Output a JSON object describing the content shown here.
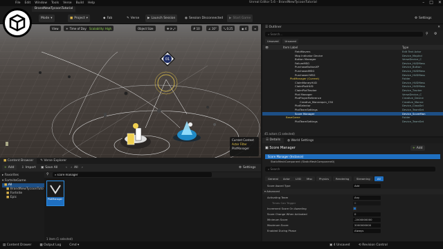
{
  "window": {
    "title": "Unreal Editor 5.6 - BrandNewTycoonTutorial",
    "menus": [
      "File",
      "Edit",
      "Window",
      "Tools",
      "Verse",
      "Build",
      "Help"
    ]
  },
  "toolbar": {
    "project_tab": "BrandNewTycoonTutorial",
    "mode": "Mode",
    "project": "Project",
    "fab": "Fab",
    "verse": "Verse",
    "launch": "Launch Session",
    "session": "Session Disconnected",
    "start": "Start Game",
    "settings": "Settings"
  },
  "viewport": {
    "perspective": "View",
    "time": "Time of Day",
    "scalability": "Scalability: High",
    "object_size": "Object Size",
    "grid": "10",
    "angle": "10°",
    "scale": "0.25",
    "speed": "4",
    "marker_label": "01",
    "context_title": "Current Context",
    "context_filter": "Actor Filter",
    "context_item": "PlotManager"
  },
  "content_browser": {
    "tab": "Content Browser",
    "verse_tab": "Verse Explorer",
    "add": "Add",
    "import": "Import",
    "save_all": "Save All",
    "path": "All",
    "settings": "Settings",
    "search": "score manager",
    "favorites": "Favorites",
    "project": "FortniteGame",
    "tree": [
      "All",
      "BrandNewTycoonTuto",
      "Fortnite",
      "Epic"
    ],
    "asset_name": "PlotManager",
    "count": "1 item (1 selected)"
  },
  "outliner": {
    "title": "Outliner",
    "search": "Search...",
    "filter_a": "Unsaved",
    "filter_b": "Unsaved",
    "col_item": "Item Label",
    "col_type": "Type",
    "count": "45 actors (1 selected)",
    "rows": [
      {
        "name": "FieldMovers",
        "type": "Edit Text Actor"
      },
      {
        "name": "Map Indicator Device",
        "type": "Device_MapInd"
      },
      {
        "name": "Button Manager",
        "type": "VerseDevice_C"
      },
      {
        "name": "FailureMSG",
        "type": "Device_HUDMess"
      },
      {
        "name": "PurchaseButtonXP",
        "type": "Device_Button"
      },
      {
        "name": "PurchasedMSG",
        "type": "Device_HUDMess"
      },
      {
        "name": "Purchased MSG",
        "type": "Device_HUDMess"
      },
      {
        "name": "PlotManager (Current)",
        "type": "Folder"
      },
      {
        "name": "ClaimMoneyHUD",
        "type": "Device_HUDMess"
      },
      {
        "name": "ClaimPlotHUD",
        "type": "Device_HUDMess"
      },
      {
        "name": "ClaimPlotTracker",
        "type": "Device_Tracker"
      },
      {
        "name": "Plot Manager",
        "type": "VerseDevice_C"
      },
      {
        "name": "PlotPlayerReference",
        "type": "Creative_Device"
      },
      {
        "name": "Creative_Mannequin_C50",
        "type": "Creative_Manne"
      },
      {
        "name": "PlotSelector",
        "type": "Device_ClassSel"
      },
      {
        "name": "PlotTeamSettings",
        "type": "Device_TeamSet"
      },
      {
        "name": "Score Manager",
        "type": "Device_ScoreMan"
      },
      {
        "name": "BaseGame",
        "type": "Folder"
      },
      {
        "name": "PlotTeamSettings",
        "type": "Device_TeamSet"
      }
    ]
  },
  "details": {
    "tab": "Details",
    "world_tab": "World Settings",
    "actor": "Score Manager",
    "add": "Add",
    "instance": "Score Manager (Instance)",
    "component": "StaticMeshComponent (StaticMeshComponent0)",
    "search": "Search",
    "categories": [
      "General",
      "Actor",
      "LOD",
      "Misc",
      "Physics",
      "Rendering",
      "Streaming",
      "All"
    ],
    "props": [
      {
        "label": "Score Award Type",
        "value": "Add"
      },
      {
        "label": "Advanced",
        "value": ""
      },
      {
        "label": "Activating Team",
        "value": "Any"
      },
      {
        "label": "Times Can Trigger",
        "value": "0"
      },
      {
        "label": "Increment Score On Awarding",
        "value": ""
      },
      {
        "label": "Score Change When Activated",
        "value": "0"
      },
      {
        "label": "Minimum Score",
        "value": "-2000000000"
      },
      {
        "label": "Maximum Score",
        "value": "2000000000"
      },
      {
        "label": "Enabled During Phase",
        "value": "Always"
      }
    ]
  },
  "status": {
    "drawer": "Content Drawer",
    "log": "Output Log",
    "cmd": "Cmd",
    "unsaved": "4 Unsaved",
    "revision": "Revision Control",
    "cursor": "Source Control Off"
  }
}
